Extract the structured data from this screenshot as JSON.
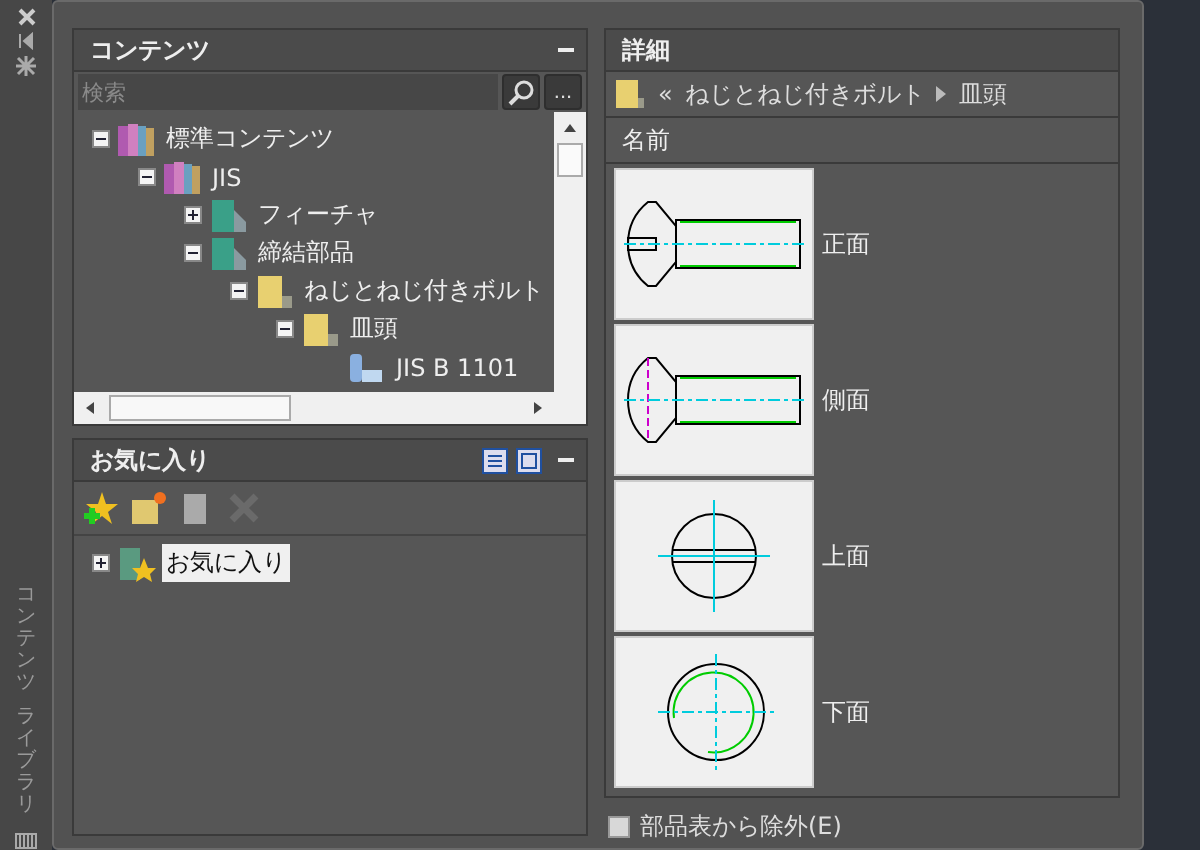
{
  "side_strip": {
    "title": [
      "コンテンツ",
      "ライブラリ"
    ]
  },
  "contents": {
    "title": "コンテンツ",
    "search": {
      "placeholder": "検索"
    },
    "more_button": "...",
    "tree": [
      {
        "label": "標準コンテンツ",
        "kind": "library",
        "expanded": true,
        "children": [
          {
            "label": "JIS",
            "kind": "library",
            "expanded": true,
            "children": [
              {
                "label": "フィーチャ",
                "kind": "category",
                "expanded": false
              },
              {
                "label": "締結部品",
                "kind": "category",
                "expanded": true,
                "children": [
                  {
                    "label": "ねじとねじ付きボルト",
                    "kind": "folder",
                    "expanded": true,
                    "children": [
                      {
                        "label": "皿頭",
                        "kind": "folder",
                        "expanded": true,
                        "children": [
                          {
                            "label": "JIS B 1101",
                            "kind": "part"
                          }
                        ]
                      }
                    ]
                  }
                ]
              }
            ]
          }
        ]
      }
    ]
  },
  "favorites": {
    "title": "お気に入り",
    "tree": [
      {
        "label": "お気に入り",
        "kind": "favorite",
        "expanded": false,
        "selected": true
      }
    ]
  },
  "details": {
    "title": "詳細",
    "breadcrumb": {
      "back": "«",
      "path": [
        "ねじとねじ付きボルト",
        "皿頭"
      ]
    },
    "column": "名前",
    "views": [
      {
        "label": "正面",
        "kind": "front"
      },
      {
        "label": "側面",
        "kind": "side"
      },
      {
        "label": "上面",
        "kind": "top"
      },
      {
        "label": "下面",
        "kind": "bottom"
      }
    ],
    "exclude_checkbox": {
      "label": "部品表から除外(E)",
      "checked": false
    }
  }
}
